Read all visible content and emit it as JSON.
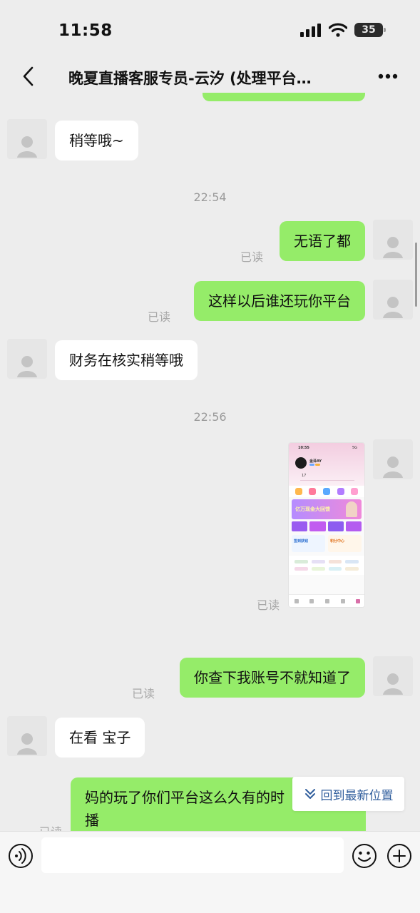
{
  "status": {
    "time": "11:58",
    "battery": "35"
  },
  "header": {
    "title": "晚夏直播客服专员-云汐 (处理平台…"
  },
  "messages": {
    "m1": {
      "text": "稍等哦~"
    },
    "t1": "22:54",
    "m2": {
      "text": "无语了都",
      "read": "已读"
    },
    "m3": {
      "text": "这样以后谁还玩你平台",
      "read": "已读"
    },
    "m4": {
      "text": "财务在核实稍等哦"
    },
    "t2": "22:56",
    "m5": {
      "read": "已读",
      "thumb": {
        "time": "10:55",
        "status": "5G",
        "username": "金泽AY",
        "headline": "亿万现金大回馈",
        "card_left": "签到获钱",
        "card_right": "积分中心",
        "stat_count": "17"
      }
    },
    "m6": {
      "text": "你查下我账号不就知道了",
      "read": "已读"
    },
    "m7": {
      "text": "在看 宝子"
    },
    "m8": {
      "line1": "妈的玩了你们平台这么久有的时",
      "line2": "播",
      "read": "已读"
    }
  },
  "jump_button": {
    "label": "回到最新位置"
  },
  "colors": {
    "outgoing_bubble": "#95ec69",
    "incoming_bubble": "#ffffff",
    "background": "#ededed",
    "link": "#2f5d9c"
  }
}
